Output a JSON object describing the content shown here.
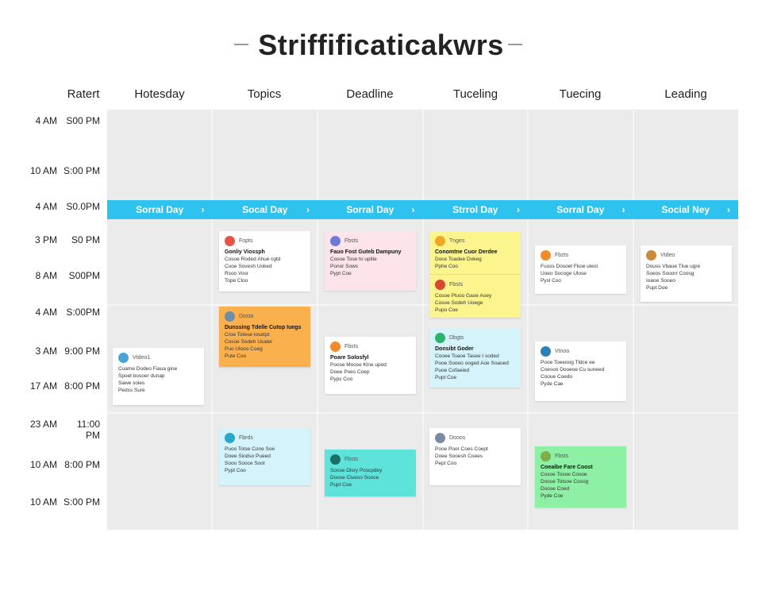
{
  "title": "Striffificaticakwrs",
  "columns": [
    "Ratert",
    "Hotesday",
    "Topics",
    "Deadline",
    "Tuceling",
    "Tuecing",
    "Leading"
  ],
  "banner": [
    "Sorral Day",
    "Socal Day",
    "Sorral Day",
    "Strrol Day",
    "Sorral Day",
    "Social Ney"
  ],
  "times": [
    [
      "4 AM",
      "S00 PM"
    ],
    [
      "10 AM",
      "S:00 PM"
    ],
    [
      "4 AM",
      "S0.0PM"
    ],
    [
      "3 PM",
      "S0 PM"
    ],
    [
      "8 AM",
      "S00PM"
    ],
    [
      "4 AM",
      "S:00PM"
    ],
    [
      "3 AM",
      "9:00 PM"
    ],
    [
      "17 AM",
      "8:00 PM"
    ],
    [
      "23 AM",
      "11:00 PM"
    ],
    [
      "10 AM",
      "8:00 PM"
    ],
    [
      "10 AM",
      "S:00 PM"
    ]
  ],
  "cards": [
    {
      "col": 0,
      "bg": "#ffffff",
      "icon": "#4aa3d8",
      "label": "Vtdeo1",
      "title": "",
      "lines": [
        "Cuame Dodeo Fiaua gine",
        "Spoet bosoer dunap",
        "Sawe soies",
        "Pedss Sure"
      ]
    },
    {
      "col": 1,
      "bg": "#ffffff",
      "icon": "#e5534b",
      "label": "Fopts",
      "title": "Gonliy Viossph",
      "lines": [
        "Cosoe Roded Ahue cgtd",
        "Cuoe Sovesh Uoked",
        "Rsoo Vosr",
        "Tope Cloo"
      ]
    },
    {
      "col": 1,
      "bg": "#fbb04e",
      "icon": "#6b8fa8",
      "label": "Dosta",
      "title": "Dunssing Tdelle Cutop Iuegs",
      "lines": [
        "Croe Totese Iosetpt",
        "Cosoe Sodeh Ucater",
        "Puo Ulooo Coeg",
        "Pute Coo"
      ]
    },
    {
      "col": 1,
      "bg": "#d5f3fb",
      "icon": "#29a9c8",
      "label": "Fbrds",
      "title": "",
      "lines": [
        "Puoo Totse Cone Soe",
        "Doee Siodso Pueed",
        "Sooo Sooce Soot",
        "Pypt Coo"
      ]
    },
    {
      "col": 2,
      "bg": "#fde4ea",
      "icon": "#6c7bd8",
      "label": "Fbsts",
      "title": "Fauo Fost Guteb Dampuny",
      "lines": [
        "Cosoe Tose to uplite",
        "Ponor Sows",
        "Pypt Coe"
      ]
    },
    {
      "col": 2,
      "bg": "#ffffff",
      "icon": "#f08a2c",
      "label": "Fbsts",
      "title": "Poare Solosfyl",
      "lines": [
        "Poose Moose Klne upod",
        "Doee Poes Coep",
        "Pyps Coo"
      ]
    },
    {
      "col": 2,
      "bg": "#5de3da",
      "icon": "#1a6f6a",
      "label": "Fbsts",
      "title": "",
      "lines": [
        "Soose Dlsry Poscpdey",
        "Doose Clueso Sooce",
        "Pupt Coe"
      ]
    },
    {
      "col": 3,
      "bg": "#fcf58e",
      "icon": "#f2a623",
      "label": "Tnges",
      "title": "Conomtne Cuor Derdee",
      "lines": [
        "Doce Toadee Dokeg",
        "Pphe Coo"
      ]
    },
    {
      "col": 3,
      "bg": "#fcf58e",
      "icon": "#d9472f",
      "label": "Fbsts",
      "title": "",
      "lines": [
        "Cosoe Pluoo Gaoe Aoey",
        "Cosoe Sodeh Uoege",
        "Pupo Coe"
      ]
    },
    {
      "col": 3,
      "bg": "#d5f3fb",
      "icon": "#2bb36b",
      "label": "Dbgts",
      "title": "Donsibt Goder",
      "lines": [
        "Cooee Toaoe Tasee t soded",
        "Pooe Sooeo ooged Aoe Soaoed",
        "Puoe Cofaeied",
        "Pupt Coe"
      ]
    },
    {
      "col": 3,
      "bg": "#ffffff",
      "icon": "#7a8aa0",
      "label": "Dooos",
      "title": "",
      "lines": [
        "Pooe Poor Coes Coept",
        "Doee Sooesh Coees",
        "Pept Coo"
      ]
    },
    {
      "col": 4,
      "bg": "#ffffff",
      "icon": "#f08a2c",
      "label": "Fbzts",
      "title": "",
      "lines": [
        "Fuoss Dosoet Fkoe uleol",
        "Uoeo Socoge Ulose",
        "Pysl Coo"
      ]
    },
    {
      "col": 4,
      "bg": "#ffffff",
      "icon": "#2d7fb8",
      "label": "Vtnoo",
      "title": "",
      "lines": [
        "Pooe Toeeoog Tldce ee",
        "Coesoo Dooeoe Cu suneed",
        "Cooue Coedo",
        "Pyde Cae"
      ]
    },
    {
      "col": 4,
      "bg": "#8ef0a4",
      "icon": "#7ab04a",
      "label": "Fbsts",
      "title": "Coeaibe Fare Coost",
      "lines": [
        "Cosoe Tosoe Cosoe",
        "Doose Totsoe Cosog",
        "Doose Coed",
        "Pyde Coe"
      ]
    },
    {
      "col": 5,
      "bg": "#ffffff",
      "icon": "#c98a3a",
      "label": "Vtdeo",
      "title": "",
      "lines": [
        "Douss Vbaue Tlue ugre",
        "Soeos Sooorr Coosg",
        "Ioaoe Sooeo",
        "Pupt Doe"
      ]
    }
  ]
}
